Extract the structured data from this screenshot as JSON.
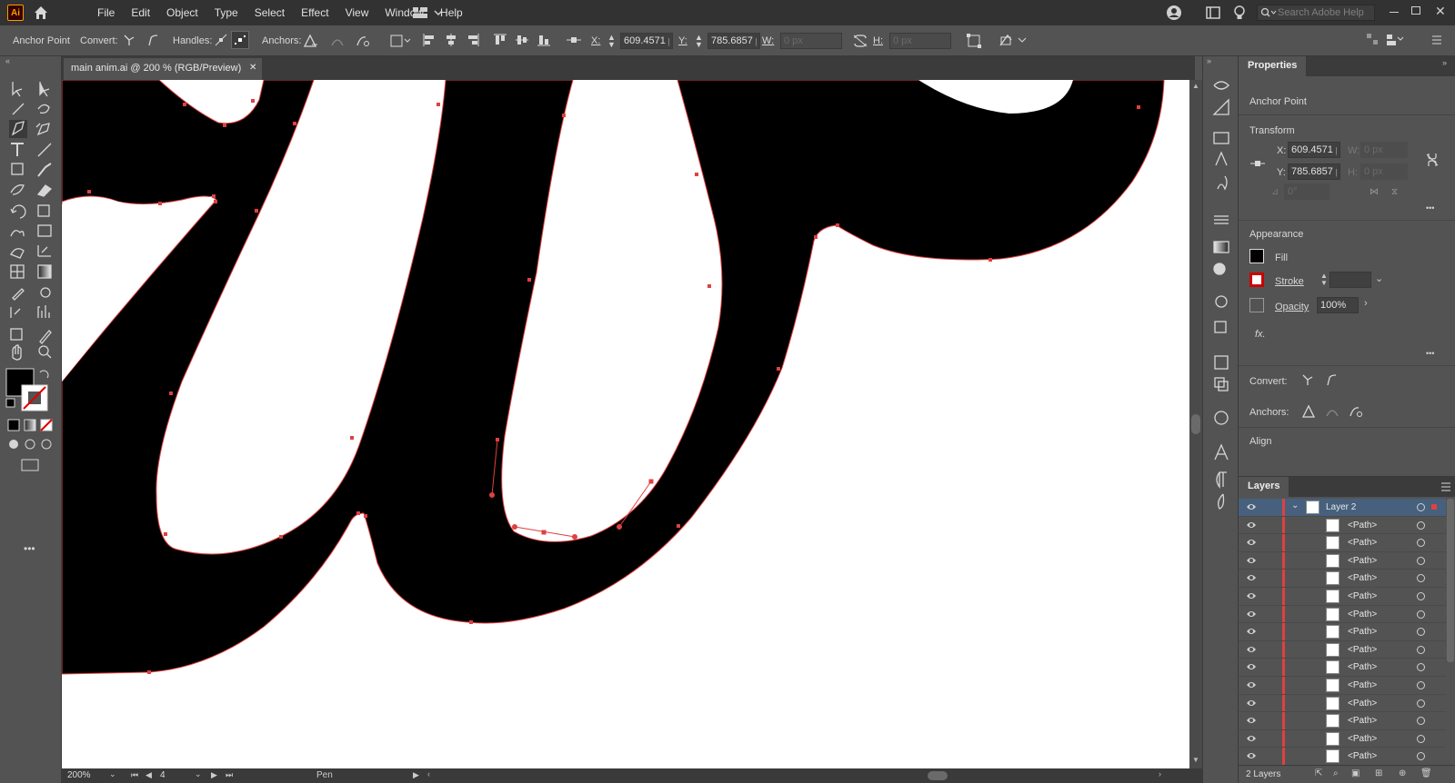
{
  "app": {
    "logo": "Ai"
  },
  "menu": [
    "File",
    "Edit",
    "Object",
    "Type",
    "Select",
    "Effect",
    "View",
    "Window",
    "Help"
  ],
  "search": {
    "placeholder": "Search Adobe Help"
  },
  "controlbar": {
    "selection_label": "Anchor Point",
    "convert_label": "Convert:",
    "handles_label": "Handles:",
    "anchors_label": "Anchors:",
    "x_label": "X:",
    "x_value": "609.4571 p",
    "y_label": "Y:",
    "y_value": "785.6857 p",
    "w_label": "W:",
    "w_value": "0 px",
    "h_label": "H:",
    "h_value": "0 px"
  },
  "document": {
    "tab_title": "main anim.ai @ 200 % (RGB/Preview)",
    "close": "✕"
  },
  "status": {
    "zoom": "200%",
    "artboard": "4",
    "tool": "Pen"
  },
  "properties": {
    "title": "Properties",
    "selection": "Anchor Point",
    "transform_label": "Transform",
    "x_label": "X:",
    "x_value": "609.4571 p",
    "y_label": "Y:",
    "y_value": "785.6857 p",
    "w_label": "W:",
    "w_value": "0 px",
    "h_label": "H:",
    "h_value": "0 px",
    "angle_value": "0°",
    "appearance_label": "Appearance",
    "fill_label": "Fill",
    "stroke_label": "Stroke",
    "opacity_label": "Opacity",
    "opacity_value": "100%",
    "fx_label": "fx.",
    "convert_label": "Convert:",
    "anchors_label": "Anchors:",
    "align_label": "Align",
    "more": "•••"
  },
  "layers": {
    "title": "Layers",
    "parent": "Layer 2",
    "items": [
      "<Path>",
      "<Path>",
      "<Path>",
      "<Path>",
      "<Path>",
      "<Path>",
      "<Path>",
      "<Path>",
      "<Path>",
      "<Path>",
      "<Path>",
      "<Path>",
      "<Path>",
      "<Path>"
    ],
    "footer_count": "2 Layers"
  },
  "colors": {
    "accent": "#e04040",
    "selection": "#46607d",
    "ui_bg": "#535353",
    "ui_dark": "#323232"
  }
}
